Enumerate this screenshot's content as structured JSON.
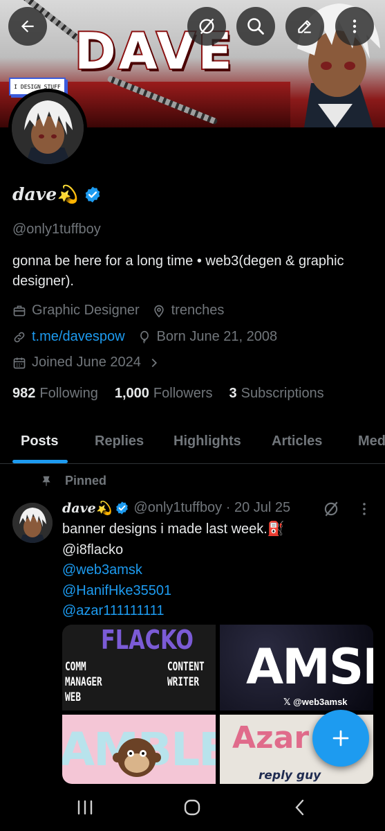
{
  "banner": {
    "title": "DAVE",
    "tag": "I DESIGN STUFF"
  },
  "toolbar": {
    "back": "back-arrow-icon",
    "grok": "grok-icon",
    "search": "search-icon",
    "edit": "edit-icon",
    "more": "more-vertical-icon"
  },
  "profile": {
    "name": "dave💫",
    "handle": "@only1tuffboy",
    "bio": "gonna be here for a long time • web3(degen & graphic designer).",
    "profession": "Graphic Designer",
    "location": "trenches",
    "website": "t.me/davespow",
    "birthday": "Born June 21, 2008",
    "joined": "Joined June 2024",
    "stats": {
      "following_count": "982",
      "following_label": "Following",
      "followers_count": "1,000",
      "followers_label": "Followers",
      "subs_count": "3",
      "subs_label": "Subscriptions"
    }
  },
  "tabs": [
    "Posts",
    "Replies",
    "Highlights",
    "Articles",
    "Med"
  ],
  "post": {
    "pinned_label": "Pinned",
    "author": "dave💫",
    "handle_date": "@only1tuffboy · 20 Jul 25",
    "line1": "banner designs i made last week.⛽",
    "mentions": [
      "@i8flacko",
      "@web3amsk",
      "@HanifHke35501",
      "@azar111111111"
    ],
    "media": {
      "t1_top": "FLACKO",
      "t1_left": "COMM MANAGER WEB",
      "t1_right": "CONTENT WRITER",
      "t2_big": "AMSI",
      "t2_credit": "𝕏 @web3amsk",
      "t3_text": "AMBLE",
      "t4_text": "Azar",
      "t4_sub": "reply guy"
    }
  },
  "colors": {
    "accent": "#1d9bf0",
    "muted": "#71767b",
    "text": "#e7e9ea",
    "background": "#000000"
  }
}
